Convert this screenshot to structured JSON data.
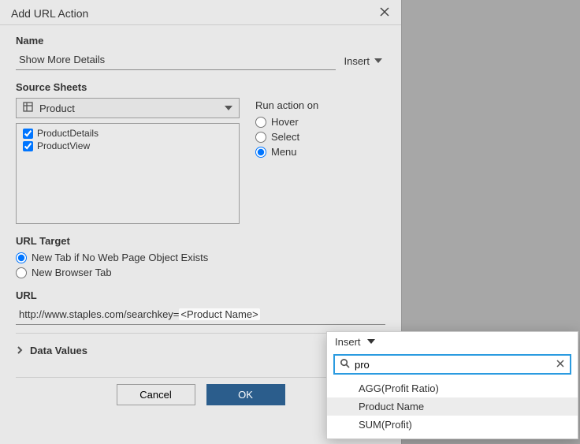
{
  "dialog": {
    "title": "Add URL Action",
    "name_label": "Name",
    "name_value": "Show More Details",
    "insert_label": "Insert",
    "source_label": "Source Sheets",
    "source_select": "Product",
    "sheet_items": [
      {
        "label": "ProductDetails",
        "checked": true
      },
      {
        "label": "ProductView",
        "checked": true
      }
    ],
    "run_label": "Run action on",
    "run_options": [
      {
        "label": "Hover",
        "selected": false
      },
      {
        "label": "Select",
        "selected": false
      },
      {
        "label": "Menu",
        "selected": true
      }
    ],
    "target_label": "URL Target",
    "target_options": [
      {
        "label": "New Tab if No Web Page Object Exists",
        "selected": true
      },
      {
        "label": "New Browser Tab",
        "selected": false
      }
    ],
    "url_label": "URL",
    "url_prefix": "http://www.staples.com/searchkey=",
    "url_token": "<Product Name>",
    "datavalues_label": "Data Values",
    "cancel": "Cancel",
    "ok": "OK"
  },
  "dropdown": {
    "insert_label": "Insert",
    "search_value": "pro",
    "items": [
      {
        "label": "AGG(Profit Ratio)",
        "highlight": false
      },
      {
        "label": "Product Name",
        "highlight": true
      },
      {
        "label": "SUM(Profit)",
        "highlight": false
      }
    ]
  }
}
